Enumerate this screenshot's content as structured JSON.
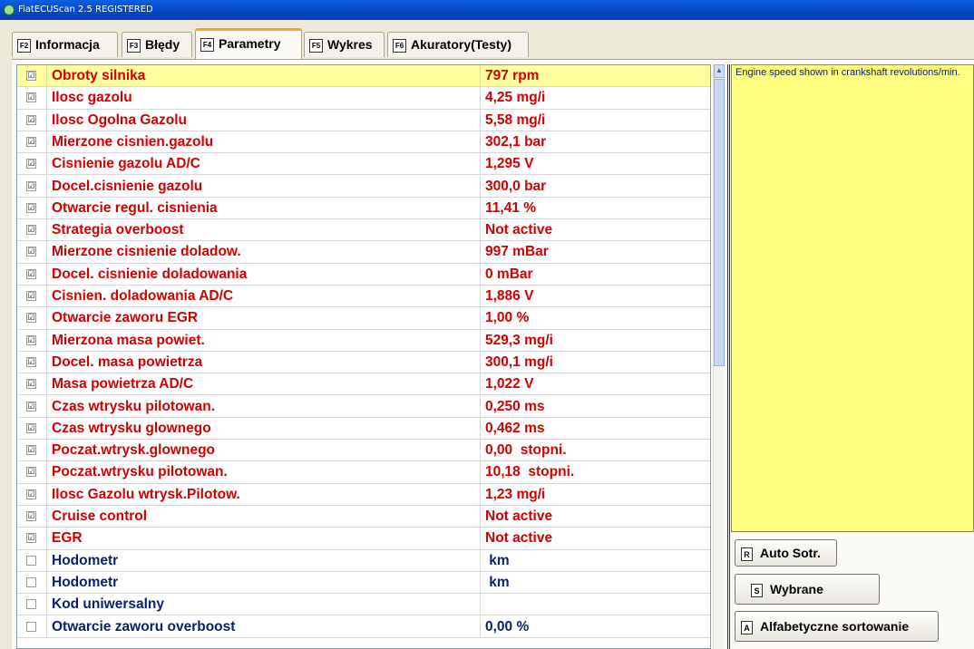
{
  "window": {
    "title": "FiatECUScan 2.5 REGISTERED"
  },
  "tabs": [
    {
      "key": "F2",
      "label": "Informacja"
    },
    {
      "key": "F3",
      "label": "Błędy"
    },
    {
      "key": "F4",
      "label": "Parametry",
      "active": true
    },
    {
      "key": "F5",
      "label": "Wykres"
    },
    {
      "key": "F6",
      "label": "Akuratory(Testy)"
    }
  ],
  "parameters": [
    {
      "checked": true,
      "name": "Obroty silnika",
      "value": "797 rpm",
      "color": "red",
      "selected": true
    },
    {
      "checked": true,
      "name": "Ilosc gazolu",
      "value": "4,25 mg/i",
      "color": "red"
    },
    {
      "checked": true,
      "name": "Ilosc Ogolna Gazolu",
      "value": "5,58 mg/i",
      "color": "red"
    },
    {
      "checked": true,
      "name": "Mierzone cisnien.gazolu",
      "value": "302,1 bar",
      "color": "red"
    },
    {
      "checked": true,
      "name": "Cisnienie gazolu AD/C",
      "value": "1,295 V",
      "color": "red"
    },
    {
      "checked": true,
      "name": "Docel.cisnienie gazolu",
      "value": "300,0 bar",
      "color": "red"
    },
    {
      "checked": true,
      "name": "Otwarcie regul. cisnienia",
      "value": "11,41 %",
      "color": "red"
    },
    {
      "checked": true,
      "name": "Strategia overboost",
      "value": "Not active",
      "color": "red"
    },
    {
      "checked": true,
      "name": "Mierzone cisnienie doladow.",
      "value": "997 mBar",
      "color": "red"
    },
    {
      "checked": true,
      "name": "Docel. cisnienie doladowania",
      "value": "0 mBar",
      "color": "red"
    },
    {
      "checked": true,
      "name": "Cisnien. doladowania AD/C",
      "value": "1,886 V",
      "color": "red"
    },
    {
      "checked": true,
      "name": "Otwarcie zaworu EGR",
      "value": "1,00 %",
      "color": "red"
    },
    {
      "checked": true,
      "name": "Mierzona masa powiet.",
      "value": "529,3 mg/i",
      "color": "red"
    },
    {
      "checked": true,
      "name": "Docel. masa powietrza",
      "value": "300,1 mg/i",
      "color": "red"
    },
    {
      "checked": true,
      "name": "Masa powietrza AD/C",
      "value": "1,022 V",
      "color": "red"
    },
    {
      "checked": true,
      "name": "Czas wtrysku pilotowan.",
      "value": "0,250 ms",
      "color": "red"
    },
    {
      "checked": true,
      "name": "Czas wtrysku glownego",
      "value": "0,462 ms",
      "color": "red"
    },
    {
      "checked": true,
      "name": "Poczat.wtrysk.glownego",
      "value": "0,00  stopni.",
      "color": "red"
    },
    {
      "checked": true,
      "name": "Poczat.wtrysku pilotowan.",
      "value": "10,18  stopni.",
      "color": "red"
    },
    {
      "checked": true,
      "name": "Ilosc Gazolu wtrysk.Pilotow.",
      "value": "1,23 mg/i",
      "color": "red"
    },
    {
      "checked": true,
      "name": "Cruise control",
      "value": "Not active",
      "color": "red"
    },
    {
      "checked": true,
      "name": "EGR",
      "value": "Not active",
      "color": "red"
    },
    {
      "checked": false,
      "name": "Hodometr",
      "value": " km",
      "color": "blue"
    },
    {
      "checked": false,
      "name": "Hodometr",
      "value": " km",
      "color": "blue"
    },
    {
      "checked": false,
      "name": "Kod uniwersalny",
      "value": "",
      "color": "blue"
    },
    {
      "checked": false,
      "name": "Otwarcie zaworu overboost",
      "value": "0,00 %",
      "color": "blue"
    }
  ],
  "description": "Engine speed shown in crankshaft revolutions/min.",
  "buttons": [
    {
      "key": "R",
      "label": "Auto Sotr."
    },
    {
      "key": "S",
      "label": "Wybrane"
    },
    {
      "key": "A",
      "label": "Alfabetyczne sortowanie"
    }
  ],
  "icons": {
    "checkbox_checked": "☑",
    "scroll_up": "▲"
  },
  "colors": {
    "value_active": "#d40000",
    "value_inactive": "#0a1f6e",
    "selected_row": "#ffff9e",
    "description_bg": "#ffff80",
    "active_tab_accent": "#f0a42a"
  }
}
